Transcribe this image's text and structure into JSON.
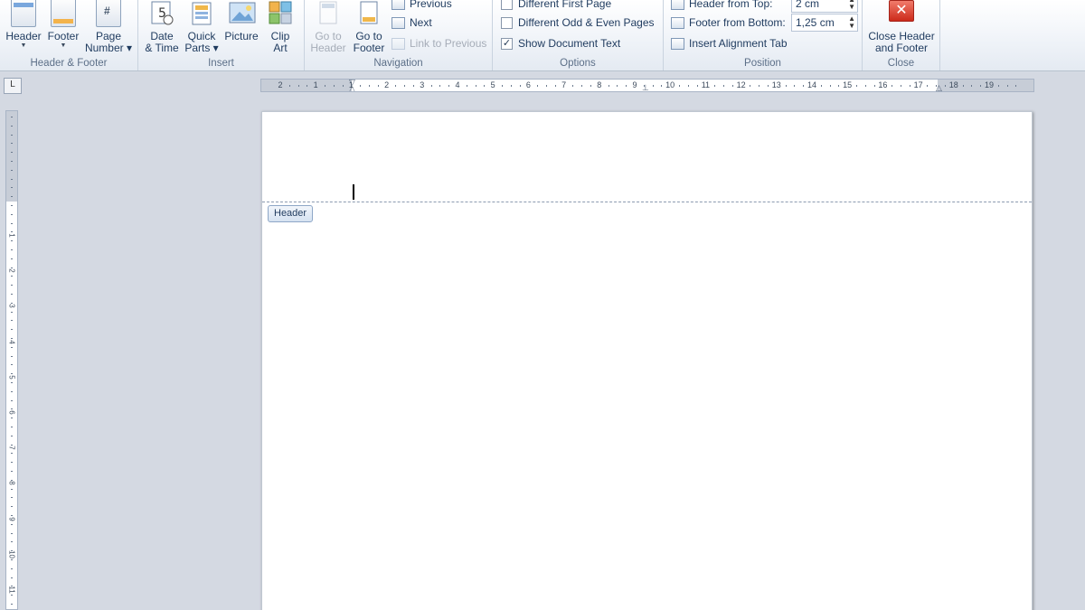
{
  "ribbon": {
    "groups": {
      "header_footer": "Header & Footer",
      "insert": "Insert",
      "navigation": "Navigation",
      "options": "Options",
      "position": "Position",
      "close": "Close"
    },
    "buttons": {
      "header": "Header",
      "footer": "Footer",
      "page_number_1": "Page",
      "page_number_2": "Number",
      "date_1": "Date",
      "date_2": "& Time",
      "quick_1": "Quick",
      "quick_2": "Parts",
      "picture": "Picture",
      "clip_1": "Clip",
      "clip_2": "Art",
      "goto_header_1": "Go to",
      "goto_header_2": "Header",
      "goto_footer_1": "Go to",
      "goto_footer_2": "Footer",
      "previous": "Previous",
      "next": "Next",
      "link_previous": "Link to Previous",
      "close_1": "Close Header",
      "close_2": "and Footer"
    },
    "options": {
      "different_first": "Different First Page",
      "different_odd_even": "Different Odd & Even Pages",
      "show_doc_text": "Show Document Text",
      "show_doc_text_checked": "✓"
    },
    "position": {
      "header_from_top_label": "Header from Top:",
      "header_from_top_value": "2 cm",
      "footer_from_bottom_label": "Footer from Bottom:",
      "footer_from_bottom_value": "1,25 cm",
      "insert_alignment_tab": "Insert Alignment Tab"
    }
  },
  "ruler": {
    "tab_selector": "L",
    "h_labels": [
      "2",
      "1",
      "1",
      "2",
      "3",
      "4",
      "5",
      "6",
      "7",
      "8",
      "9",
      "10",
      "11",
      "12",
      "13",
      "14",
      "15",
      "16",
      "17",
      "18",
      "19"
    ],
    "v_labels": [
      "1",
      "2",
      "3",
      "4",
      "5",
      "6",
      "7",
      "8",
      "9",
      "10",
      "11"
    ]
  },
  "page": {
    "header_tag": "Header"
  },
  "colors": {
    "ribbon_text": "#1e3a5e",
    "group_label": "#5c6f88",
    "workspace": "#d4d9e2",
    "close_red": "#cc2a1a"
  }
}
